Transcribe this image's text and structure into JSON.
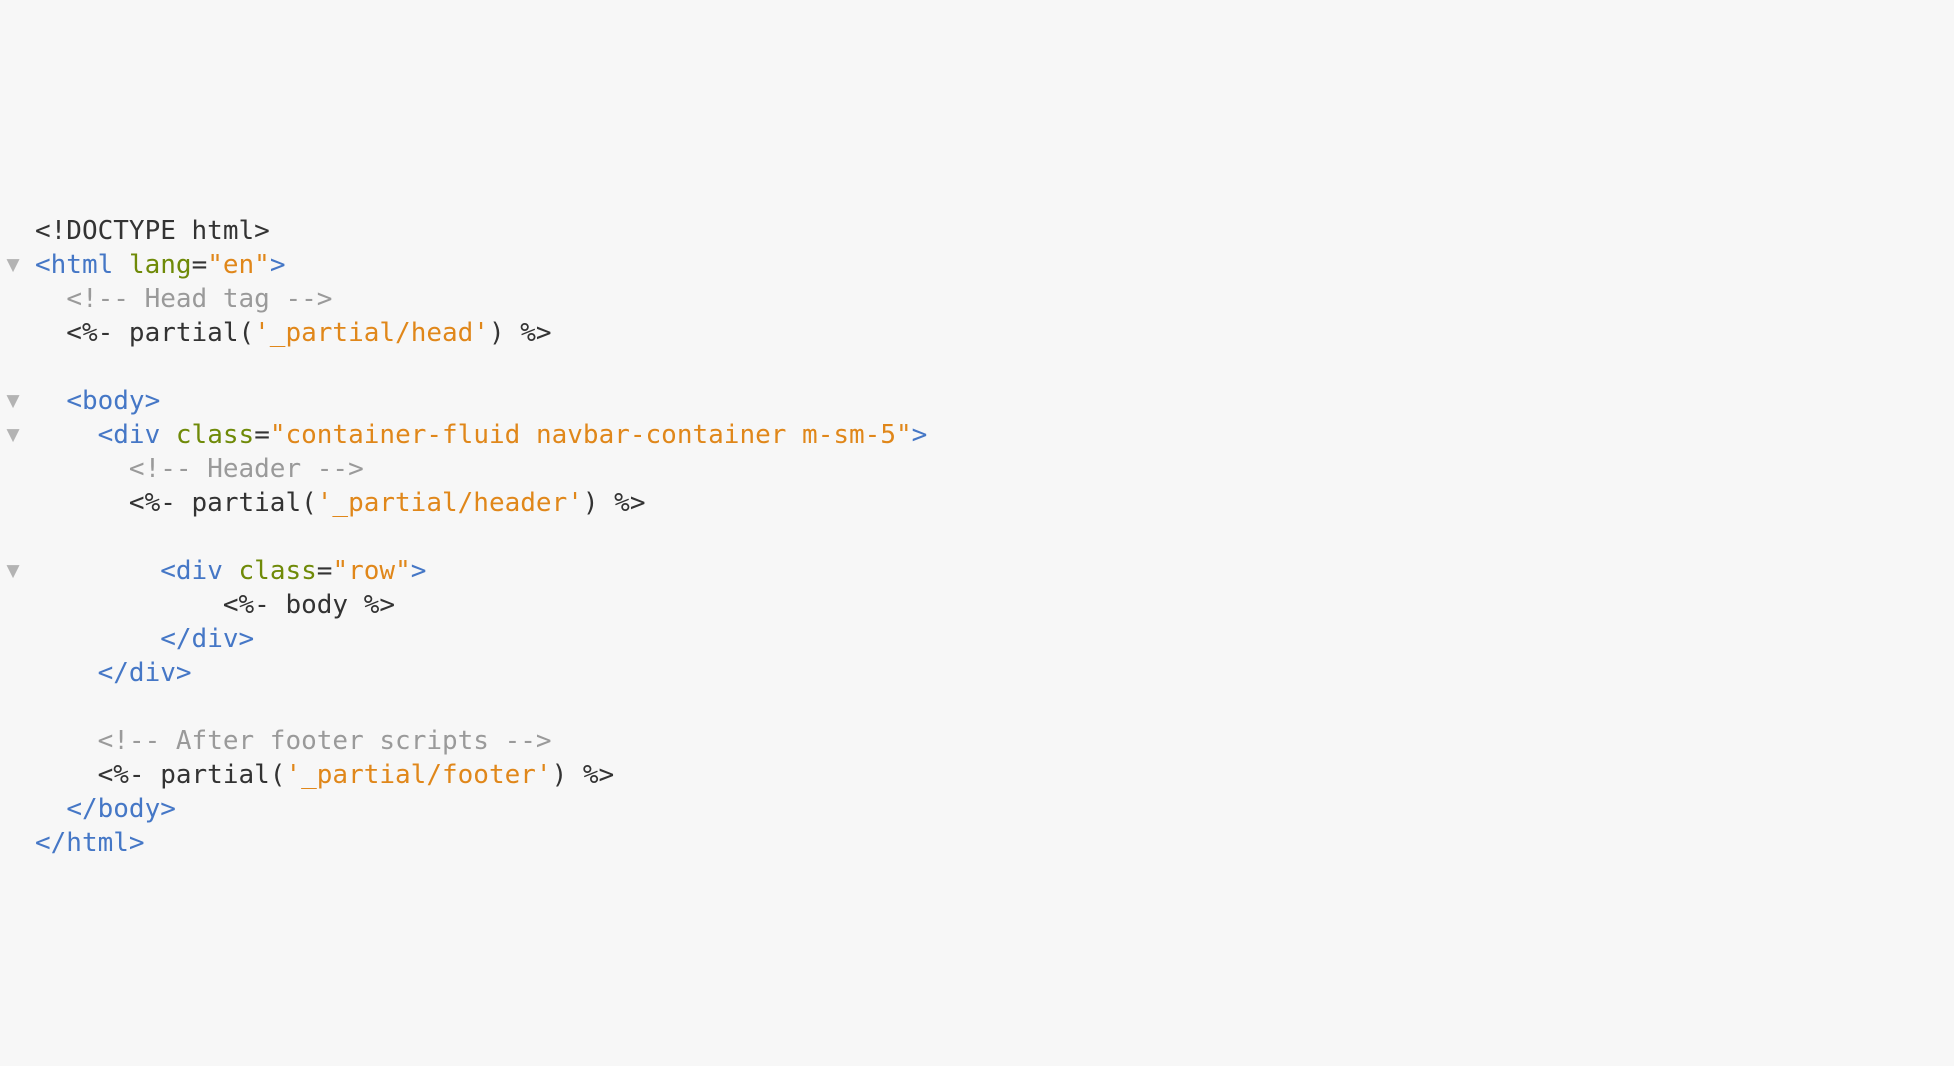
{
  "colors": {
    "background": "#f7f7f7",
    "plain": "#333333",
    "tag": "#4577c6",
    "attribute": "#6f8a08",
    "string": "#e0871a",
    "comment": "#9a9a9a",
    "fold_marker": "#b3b3b3"
  },
  "icons": {
    "fold": "fold-triangle-icon"
  },
  "code": {
    "lines": [
      {
        "fold": false,
        "tokens": [
          {
            "type": "plain",
            "text": "<!DOCTYPE html>"
          }
        ]
      },
      {
        "fold": true,
        "tokens": [
          {
            "type": "tag",
            "text": "<html"
          },
          {
            "type": "plain",
            "text": " "
          },
          {
            "type": "attr",
            "text": "lang"
          },
          {
            "type": "plain",
            "text": "="
          },
          {
            "type": "string",
            "text": "\"en\""
          },
          {
            "type": "tag",
            "text": ">"
          }
        ]
      },
      {
        "fold": false,
        "tokens": [
          {
            "type": "plain",
            "text": "  "
          },
          {
            "type": "comment",
            "text": "<!-- Head tag -->"
          }
        ]
      },
      {
        "fold": false,
        "tokens": [
          {
            "type": "plain",
            "text": "  <%- partial("
          },
          {
            "type": "string",
            "text": "'_partial/head'"
          },
          {
            "type": "plain",
            "text": ") %>"
          }
        ]
      },
      {
        "fold": false,
        "tokens": []
      },
      {
        "fold": true,
        "tokens": [
          {
            "type": "plain",
            "text": "  "
          },
          {
            "type": "tag",
            "text": "<body>"
          }
        ]
      },
      {
        "fold": true,
        "tokens": [
          {
            "type": "plain",
            "text": "    "
          },
          {
            "type": "tag",
            "text": "<div"
          },
          {
            "type": "plain",
            "text": " "
          },
          {
            "type": "attr",
            "text": "class"
          },
          {
            "type": "plain",
            "text": "="
          },
          {
            "type": "string",
            "text": "\"container-fluid navbar-container m-sm-5\""
          },
          {
            "type": "tag",
            "text": ">"
          }
        ]
      },
      {
        "fold": false,
        "tokens": [
          {
            "type": "plain",
            "text": "      "
          },
          {
            "type": "comment",
            "text": "<!-- Header -->"
          }
        ]
      },
      {
        "fold": false,
        "tokens": [
          {
            "type": "plain",
            "text": "      <%- partial("
          },
          {
            "type": "string",
            "text": "'_partial/header'"
          },
          {
            "type": "plain",
            "text": ") %>"
          }
        ]
      },
      {
        "fold": false,
        "tokens": []
      },
      {
        "fold": true,
        "tokens": [
          {
            "type": "plain",
            "text": "        "
          },
          {
            "type": "tag",
            "text": "<div"
          },
          {
            "type": "plain",
            "text": " "
          },
          {
            "type": "attr",
            "text": "class"
          },
          {
            "type": "plain",
            "text": "="
          },
          {
            "type": "string",
            "text": "\"row\""
          },
          {
            "type": "tag",
            "text": ">"
          }
        ]
      },
      {
        "fold": false,
        "tokens": [
          {
            "type": "plain",
            "text": "            <%- body %>"
          }
        ]
      },
      {
        "fold": false,
        "tokens": [
          {
            "type": "plain",
            "text": "        "
          },
          {
            "type": "tag",
            "text": "</div>"
          }
        ]
      },
      {
        "fold": false,
        "tokens": [
          {
            "type": "plain",
            "text": "    "
          },
          {
            "type": "tag",
            "text": "</div>"
          }
        ]
      },
      {
        "fold": false,
        "tokens": []
      },
      {
        "fold": false,
        "tokens": [
          {
            "type": "plain",
            "text": "    "
          },
          {
            "type": "comment",
            "text": "<!-- After footer scripts -->"
          }
        ]
      },
      {
        "fold": false,
        "tokens": [
          {
            "type": "plain",
            "text": "    <%- partial("
          },
          {
            "type": "string",
            "text": "'_partial/footer'"
          },
          {
            "type": "plain",
            "text": ") %>"
          }
        ]
      },
      {
        "fold": false,
        "tokens": [
          {
            "type": "plain",
            "text": "  "
          },
          {
            "type": "tag",
            "text": "</body>"
          }
        ]
      },
      {
        "fold": false,
        "tokens": [
          {
            "type": "tag",
            "text": "</html>"
          }
        ]
      }
    ]
  }
}
